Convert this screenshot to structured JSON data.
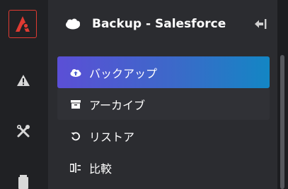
{
  "app": {
    "title": "Backup - Salesforce",
    "header_logo_text": "salesforce"
  },
  "rail": {
    "items": [
      {
        "name": "logo",
        "icon": "brand-logo-icon"
      },
      {
        "name": "alerts",
        "icon": "warning-icon"
      },
      {
        "name": "tools",
        "icon": "tools-icon"
      },
      {
        "name": "documents",
        "icon": "document-icon"
      }
    ]
  },
  "menu": {
    "items": [
      {
        "label": "バックアップ",
        "icon": "cloud-upload-icon",
        "state": "active"
      },
      {
        "label": "アーカイブ",
        "icon": "archive-icon",
        "state": "hover"
      },
      {
        "label": "リストア",
        "icon": "restore-icon",
        "state": "normal"
      },
      {
        "label": "比較",
        "icon": "compare-icon",
        "state": "normal"
      }
    ]
  },
  "colors": {
    "rail_bg": "#202124",
    "panel_bg": "#2b2c30",
    "logo_red": "#e03a32",
    "active_gradient_start": "#5b4fd6",
    "active_gradient_end": "#1386c4",
    "salesforce_blue": "#00a1e0"
  }
}
